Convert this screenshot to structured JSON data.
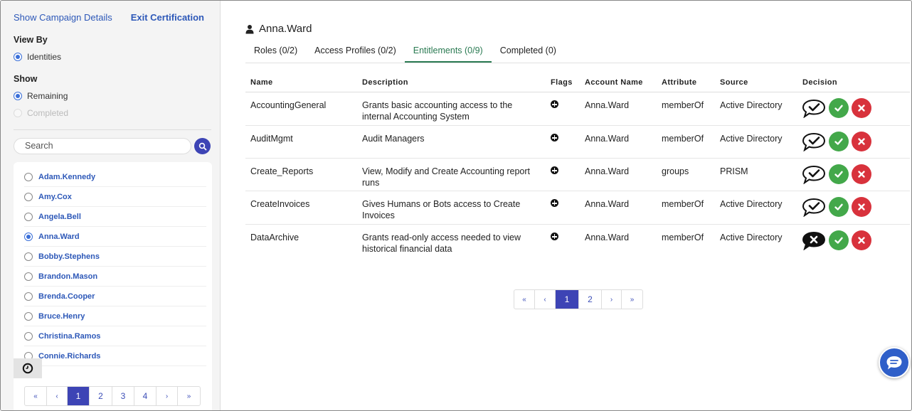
{
  "sidebar": {
    "show_campaign_details": "Show Campaign Details",
    "exit_certification": "Exit Certification",
    "view_by_title": "View By",
    "view_by_option": "Identities",
    "show_title": "Show",
    "show_options": [
      "Remaining",
      "Completed"
    ],
    "search_placeholder": "Search",
    "identities": [
      "Adam.Kennedy",
      "Amy.Cox",
      "Angela.Bell",
      "Anna.Ward",
      "Bobby.Stephens",
      "Brandon.Mason",
      "Brenda.Cooper",
      "Bruce.Henry",
      "Christina.Ramos",
      "Connie.Richards"
    ],
    "selected_identity": "Anna.Ward",
    "pager": [
      "«",
      "‹",
      "1",
      "2",
      "3",
      "4",
      "›",
      "»"
    ],
    "pager_active": "1"
  },
  "main": {
    "user_name": "Anna.Ward",
    "tabs": [
      "Roles (0/2)",
      "Access Profiles (0/2)",
      "Entitlements (0/9)",
      "Completed (0)"
    ],
    "active_tab": "Entitlements (0/9)",
    "columns": [
      "Name",
      "Description",
      "Flags",
      "Account Name",
      "Attribute",
      "Source",
      "Decision"
    ],
    "rows": [
      {
        "name": "AccountingGeneral",
        "description": "Grants basic accounting access to the internal Accounting System",
        "account": "Anna.Ward",
        "attribute": "memberOf",
        "source": "Active Directory",
        "comment_state": "check"
      },
      {
        "name": "AuditMgmt",
        "description": "Audit Managers",
        "account": "Anna.Ward",
        "attribute": "memberOf",
        "source": "Active Directory",
        "comment_state": "check"
      },
      {
        "name": "Create_Reports",
        "description": "View, Modify and Create Accounting report runs",
        "account": "Anna.Ward",
        "attribute": "groups",
        "source": "PRISM",
        "comment_state": "check"
      },
      {
        "name": "CreateInvoices",
        "description": "Gives Humans or Bots access to Create Invoices",
        "account": "Anna.Ward",
        "attribute": "memberOf",
        "source": "Active Directory",
        "comment_state": "check"
      },
      {
        "name": "DataArchive",
        "description": "Grants read-only access needed to view historical financial data",
        "account": "Anna.Ward",
        "attribute": "memberOf",
        "source": "Active Directory",
        "comment_state": "x"
      }
    ],
    "pager": [
      "«",
      "‹",
      "1",
      "2",
      "›",
      "»"
    ],
    "pager_active": "1"
  },
  "colors": {
    "accent": "#3d44b5",
    "link": "#2d58b8",
    "tab_active": "#2a7a52",
    "approve": "#43a84a",
    "revoke": "#d8323c"
  }
}
